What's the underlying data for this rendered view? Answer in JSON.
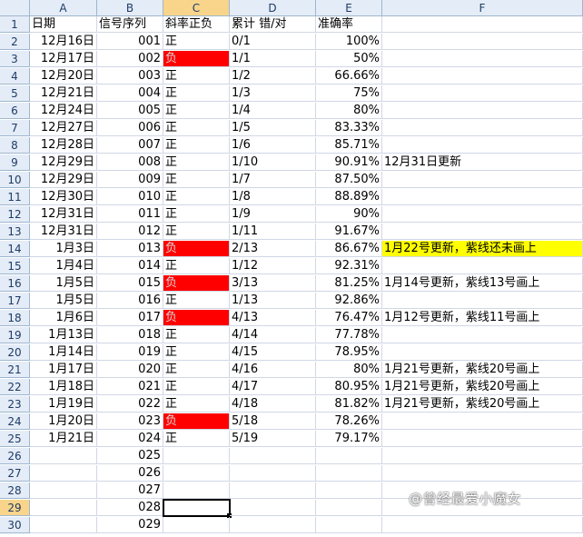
{
  "columns": [
    "A",
    "B",
    "C",
    "D",
    "E",
    "F"
  ],
  "selected_column": "C",
  "active_cell": "C29",
  "header_row": {
    "A": "日期",
    "B": "信号序列",
    "C": "斜率正负",
    "D": "累计 错/对",
    "E": "准确率",
    "F": ""
  },
  "rows": [
    {
      "n": "2",
      "A": "12月16日",
      "B": "001",
      "C": "正",
      "D": "0/1",
      "E": "100%",
      "F": ""
    },
    {
      "n": "3",
      "A": "12月17日",
      "B": "002",
      "C": "负",
      "D": "1/1",
      "E": "50%",
      "F": ""
    },
    {
      "n": "4",
      "A": "12月20日",
      "B": "003",
      "C": "正",
      "D": "1/2",
      "E": "66.66%",
      "F": ""
    },
    {
      "n": "5",
      "A": "12月21日",
      "B": "004",
      "C": "正",
      "D": "1/3",
      "E": "75%",
      "F": ""
    },
    {
      "n": "6",
      "A": "12月24日",
      "B": "005",
      "C": "正",
      "D": "1/4",
      "E": "80%",
      "F": ""
    },
    {
      "n": "7",
      "A": "12月27日",
      "B": "006",
      "C": "正",
      "D": "1/5",
      "E": "83.33%",
      "F": ""
    },
    {
      "n": "8",
      "A": "12月28日",
      "B": "007",
      "C": "正",
      "D": "1/6",
      "E": "85.71%",
      "F": ""
    },
    {
      "n": "9",
      "A": "12月29日",
      "B": "008",
      "C": "正",
      "D": "1/10",
      "E": "90.91%",
      "F": "12月31日更新"
    },
    {
      "n": "10",
      "A": "12月29日",
      "B": "009",
      "C": "正",
      "D": "1/7",
      "E": "87.50%",
      "F": ""
    },
    {
      "n": "11",
      "A": "12月30日",
      "B": "010",
      "C": "正",
      "D": "1/8",
      "E": "88.89%",
      "F": ""
    },
    {
      "n": "12",
      "A": "12月31日",
      "B": "011",
      "C": "正",
      "D": "1/9",
      "E": "90%",
      "F": ""
    },
    {
      "n": "13",
      "A": "12月31日",
      "B": "012",
      "C": "正",
      "D": "1/11",
      "E": "91.67%",
      "F": ""
    },
    {
      "n": "14",
      "A": "1月3日",
      "B": "013",
      "C": "负",
      "D": "2/13",
      "E": "86.67%",
      "F": "1月22号更新，紫线还未画上"
    },
    {
      "n": "15",
      "A": "1月4日",
      "B": "014",
      "C": "正",
      "D": "1/12",
      "E": "92.31%",
      "F": ""
    },
    {
      "n": "16",
      "A": "1月5日",
      "B": "015",
      "C": "负",
      "D": "3/13",
      "E": "81.25%",
      "F": "1月14号更新，紫线13号画上"
    },
    {
      "n": "17",
      "A": "1月5日",
      "B": "016",
      "C": "正",
      "D": "1/13",
      "E": "92.86%",
      "F": ""
    },
    {
      "n": "18",
      "A": "1月6日",
      "B": "017",
      "C": "负",
      "D": "4/13",
      "E": "76.47%",
      "F": "1月12号更新，紫线11号画上"
    },
    {
      "n": "19",
      "A": "1月13日",
      "B": "018",
      "C": "正",
      "D": "4/14",
      "E": "77.78%",
      "F": ""
    },
    {
      "n": "20",
      "A": "1月14日",
      "B": "019",
      "C": "正",
      "D": "4/15",
      "E": "78.95%",
      "F": ""
    },
    {
      "n": "21",
      "A": "1月17日",
      "B": "020",
      "C": "正",
      "D": "4/16",
      "E": "80%",
      "F": "1月21号更新，紫线20号画上"
    },
    {
      "n": "22",
      "A": "1月18日",
      "B": "021",
      "C": "正",
      "D": "4/17",
      "E": "80.95%",
      "F": "1月21号更新，紫线20号画上"
    },
    {
      "n": "23",
      "A": "1月19日",
      "B": "022",
      "C": "正",
      "D": "4/18",
      "E": "81.82%",
      "F": "1月21号更新，紫线20号画上"
    },
    {
      "n": "24",
      "A": "1月20日",
      "B": "023",
      "C": "负",
      "D": "5/18",
      "E": "78.26%",
      "F": ""
    },
    {
      "n": "25",
      "A": "1月21日",
      "B": "024",
      "C": "正",
      "D": "5/19",
      "E": "79.17%",
      "F": ""
    },
    {
      "n": "26",
      "A": "",
      "B": "025",
      "C": "",
      "D": "",
      "E": "",
      "F": ""
    },
    {
      "n": "27",
      "A": "",
      "B": "026",
      "C": "",
      "D": "",
      "E": "",
      "F": ""
    },
    {
      "n": "28",
      "A": "",
      "B": "027",
      "C": "",
      "D": "",
      "E": "",
      "F": ""
    },
    {
      "n": "29",
      "A": "",
      "B": "028",
      "C": "",
      "D": "",
      "E": "",
      "F": ""
    },
    {
      "n": "30",
      "A": "",
      "B": "029",
      "C": "",
      "D": "",
      "E": "",
      "F": ""
    }
  ],
  "negative_value": "负",
  "negative_fill_color": "#ff0000",
  "highlight_row": "14",
  "highlight_color": "#ffff00",
  "watermark": "@曾经最爱小魔女"
}
